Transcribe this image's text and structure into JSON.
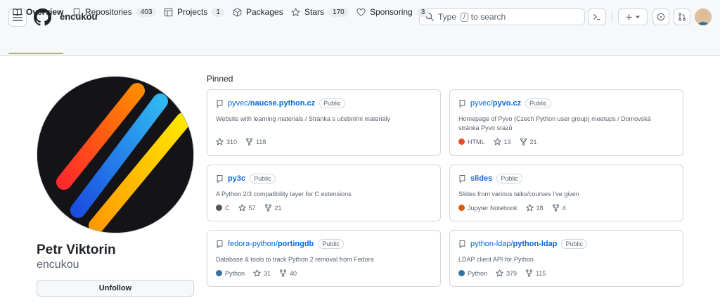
{
  "header": {
    "owner": "encukou",
    "search_type": "Type",
    "search_key": "/",
    "search_rest": "to search"
  },
  "tabs": [
    {
      "label": "Overview",
      "icon": "book-icon"
    },
    {
      "label": "Repositories",
      "count": "403",
      "icon": "repo-icon"
    },
    {
      "label": "Projects",
      "count": "1",
      "icon": "table-icon"
    },
    {
      "label": "Packages",
      "icon": "package-icon"
    },
    {
      "label": "Stars",
      "count": "170",
      "icon": "star-icon"
    },
    {
      "label": "Sponsoring",
      "count": "3",
      "icon": "heart-icon"
    }
  ],
  "profile": {
    "name": "Petr Viktorin",
    "login": "encukou",
    "unfollow_label": "Unfollow"
  },
  "pinned": {
    "heading": "Pinned",
    "cards": [
      {
        "owner": "pyvec/",
        "repo": "naucse.python.cz",
        "visibility": "Public",
        "description": "Website with learning materials / Stránka s učebními materiály",
        "language": "",
        "lang_color": "",
        "stars": "310",
        "forks": "118"
      },
      {
        "owner": "pyvec/",
        "repo": "pyvo.cz",
        "visibility": "Public",
        "description": "Homepage of Pyvo (Czech Python user group) meetups / Domovská stránka Pyvo srazů",
        "language": "HTML",
        "lang_color": "#e34c26",
        "stars": "13",
        "forks": "21"
      },
      {
        "owner": "",
        "repo": "py3c",
        "visibility": "Public",
        "description": "A Python 2/3 compatibility layer for C extensions",
        "language": "C",
        "lang_color": "#555555",
        "stars": "57",
        "forks": "21"
      },
      {
        "owner": "",
        "repo": "slides",
        "visibility": "Public",
        "description": "Slides from various talks/courses I've given",
        "language": "Jupyter Notebook",
        "lang_color": "#DA5B0B",
        "stars": "18",
        "forks": "4"
      },
      {
        "owner": "fedora-python/",
        "repo": "portingdb",
        "visibility": "Public",
        "description": "Database & tools to track Python 2 removal from Fedora",
        "language": "Python",
        "lang_color": "#3572A5",
        "stars": "31",
        "forks": "40"
      },
      {
        "owner": "python-ldap/",
        "repo": "python-ldap",
        "visibility": "Public",
        "description": "LDAP client API for Python",
        "language": "Python",
        "lang_color": "#3572A5",
        "stars": "379",
        "forks": "115"
      }
    ]
  },
  "colors": {
    "accent": "#0969da",
    "tab_underline": "#fd8c73",
    "border": "#d0d7de"
  }
}
